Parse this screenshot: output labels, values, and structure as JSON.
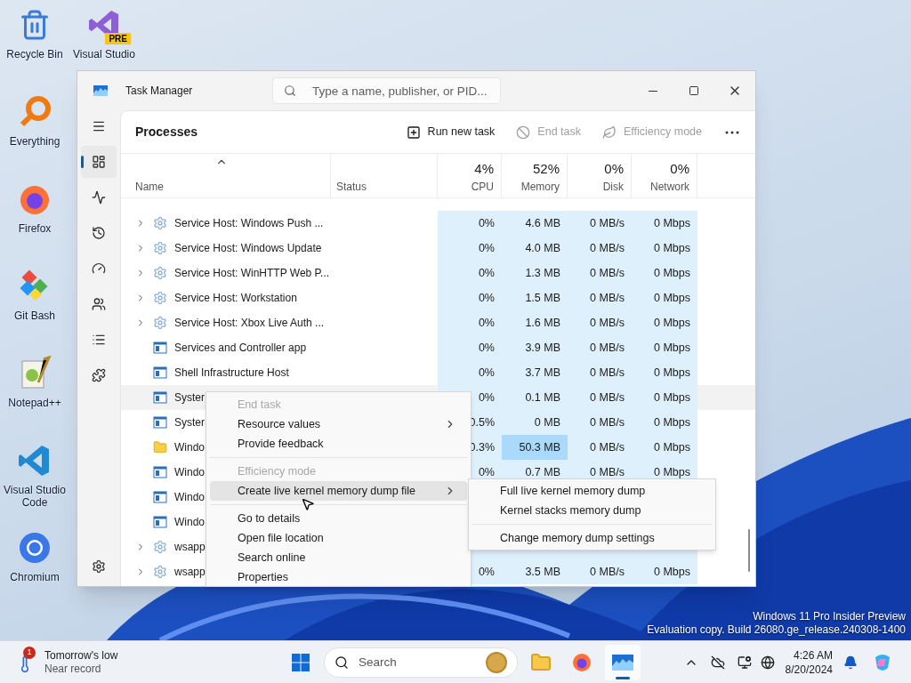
{
  "desktop_icons": [
    {
      "label": "Recycle Bin",
      "kind": "recycle"
    },
    {
      "label": "Visual Studio",
      "kind": "vs",
      "badge": "PRE"
    },
    {
      "label": "Everything",
      "kind": "everything"
    },
    {
      "label": "Firefox",
      "kind": "firefox"
    },
    {
      "label": "Git Bash",
      "kind": "git"
    },
    {
      "label": "Notepad++",
      "kind": "notepad"
    },
    {
      "label": "Visual Studio Code",
      "kind": "vscode"
    },
    {
      "label": "Chromium",
      "kind": "chromium"
    }
  ],
  "window": {
    "title": "Task Manager",
    "search_placeholder": "Type a name, publisher, or PID..."
  },
  "nav": [
    {
      "kind": "processes",
      "selected": true
    },
    {
      "kind": "performance",
      "selected": false
    },
    {
      "kind": "history",
      "selected": false
    },
    {
      "kind": "startup",
      "selected": false
    },
    {
      "kind": "users",
      "selected": false
    },
    {
      "kind": "details",
      "selected": false
    },
    {
      "kind": "services",
      "selected": false
    }
  ],
  "page_title": "Processes",
  "toolbar": [
    {
      "label": "Run new task",
      "kind": "run",
      "disabled": false
    },
    {
      "label": "End task",
      "kind": "end",
      "disabled": true
    },
    {
      "label": "Efficiency mode",
      "kind": "eco",
      "disabled": true
    }
  ],
  "columns": [
    {
      "label": "Name"
    },
    {
      "label": "Status"
    },
    {
      "label": "CPU",
      "value": "4%"
    },
    {
      "label": "Memory",
      "value": "52%"
    },
    {
      "label": "Disk",
      "value": "0%"
    },
    {
      "label": "Network",
      "value": "0%"
    }
  ],
  "rows": [
    {
      "name": "Service Host: Windows Push ...",
      "kind": "service",
      "expandable": true,
      "selected": false,
      "cpu": "0%",
      "memory": "4.6 MB",
      "disk": "0 MB/s",
      "network": "0 Mbps",
      "memory_hot": false
    },
    {
      "name": "Service Host: Windows Update",
      "kind": "service",
      "expandable": true,
      "selected": false,
      "cpu": "0%",
      "memory": "4.0 MB",
      "disk": "0 MB/s",
      "network": "0 Mbps",
      "memory_hot": false
    },
    {
      "name": "Service Host: WinHTTP Web P...",
      "kind": "service",
      "expandable": true,
      "selected": false,
      "cpu": "0%",
      "memory": "1.3 MB",
      "disk": "0 MB/s",
      "network": "0 Mbps",
      "memory_hot": false
    },
    {
      "name": "Service Host: Workstation",
      "kind": "service",
      "expandable": true,
      "selected": false,
      "cpu": "0%",
      "memory": "1.5 MB",
      "disk": "0 MB/s",
      "network": "0 Mbps",
      "memory_hot": false
    },
    {
      "name": "Service Host: Xbox Live Auth ...",
      "kind": "service",
      "expandable": true,
      "selected": false,
      "cpu": "0%",
      "memory": "1.6 MB",
      "disk": "0 MB/s",
      "network": "0 Mbps",
      "memory_hot": false
    },
    {
      "name": "Services and Controller app",
      "kind": "app",
      "expandable": false,
      "selected": false,
      "cpu": "0%",
      "memory": "3.9 MB",
      "disk": "0 MB/s",
      "network": "0 Mbps",
      "memory_hot": false
    },
    {
      "name": "Shell Infrastructure Host",
      "kind": "app",
      "expandable": false,
      "selected": false,
      "cpu": "0%",
      "memory": "3.7 MB",
      "disk": "0 MB/s",
      "network": "0 Mbps",
      "memory_hot": false
    },
    {
      "name": "Syster",
      "kind": "app",
      "expandable": false,
      "selected": true,
      "cpu": "0%",
      "memory": "0.1 MB",
      "disk": "0 MB/s",
      "network": "0 Mbps",
      "memory_hot": false
    },
    {
      "name": "Syster",
      "kind": "app",
      "expandable": false,
      "selected": false,
      "cpu": "0.5%",
      "memory": "0 MB",
      "disk": "0 MB/s",
      "network": "0 Mbps",
      "memory_hot": false
    },
    {
      "name": "Windo",
      "kind": "folder",
      "expandable": false,
      "selected": false,
      "cpu": "0.3%",
      "memory": "50.3 MB",
      "disk": "0 MB/s",
      "network": "0 Mbps",
      "memory_hot": true
    },
    {
      "name": "Windo",
      "kind": "app",
      "expandable": false,
      "selected": false,
      "cpu": "0%",
      "memory": "0.7 MB",
      "disk": "0 MB/s",
      "network": "0 Mbps",
      "memory_hot": false
    },
    {
      "name": "Windo",
      "kind": "app",
      "expandable": false,
      "selected": false
    },
    {
      "name": "Windo",
      "kind": "app",
      "expandable": false,
      "selected": false
    },
    {
      "name": "wsapp",
      "kind": "service",
      "expandable": true,
      "selected": false
    },
    {
      "name": "wsapp",
      "kind": "service",
      "expandable": true,
      "selected": false,
      "cpu": "0%",
      "memory": "3.5 MB",
      "disk": "0 MB/s",
      "network": "0 Mbps",
      "memory_hot": false
    }
  ],
  "context_menu": [
    {
      "kind": "item",
      "label": "End task",
      "disabled": true,
      "submenu": false,
      "selected": false
    },
    {
      "kind": "item",
      "label": "Resource values",
      "disabled": false,
      "submenu": true,
      "selected": false
    },
    {
      "kind": "item",
      "label": "Provide feedback",
      "disabled": false,
      "submenu": false,
      "selected": false
    },
    {
      "kind": "separator"
    },
    {
      "kind": "item",
      "label": "Efficiency mode",
      "disabled": true,
      "submenu": false,
      "selected": false
    },
    {
      "kind": "item",
      "label": "Create live kernel memory dump file",
      "disabled": false,
      "submenu": true,
      "selected": true
    },
    {
      "kind": "separator"
    },
    {
      "kind": "item",
      "label": "Go to details",
      "disabled": false,
      "submenu": false,
      "selected": false
    },
    {
      "kind": "item",
      "label": "Open file location",
      "disabled": false,
      "submenu": false,
      "selected": false
    },
    {
      "kind": "item",
      "label": "Search online",
      "disabled": false,
      "submenu": false,
      "selected": false
    },
    {
      "kind": "item",
      "label": "Properties",
      "disabled": false,
      "submenu": false,
      "selected": false
    }
  ],
  "submenu": [
    {
      "kind": "item",
      "label": "Full live kernel memory dump"
    },
    {
      "kind": "item",
      "label": "Kernel stacks memory dump"
    },
    {
      "kind": "separator"
    },
    {
      "kind": "item",
      "label": "Change memory dump settings"
    }
  ],
  "watermark": [
    "Windows 11 Pro Insider Preview",
    "Evaluation copy. Build 26080.ge_release.240308-1400"
  ],
  "taskbar": {
    "weather": {
      "badge": "1",
      "title": "Tomorrow's low",
      "subtitle": "Near record"
    },
    "search_placeholder": "Search",
    "apps": [
      {
        "kind": "explorer",
        "active": false
      },
      {
        "kind": "firefox",
        "active": false
      },
      {
        "kind": "taskmanager",
        "active": true
      }
    ],
    "time": "4:26 AM",
    "date": "8/20/2024"
  }
}
